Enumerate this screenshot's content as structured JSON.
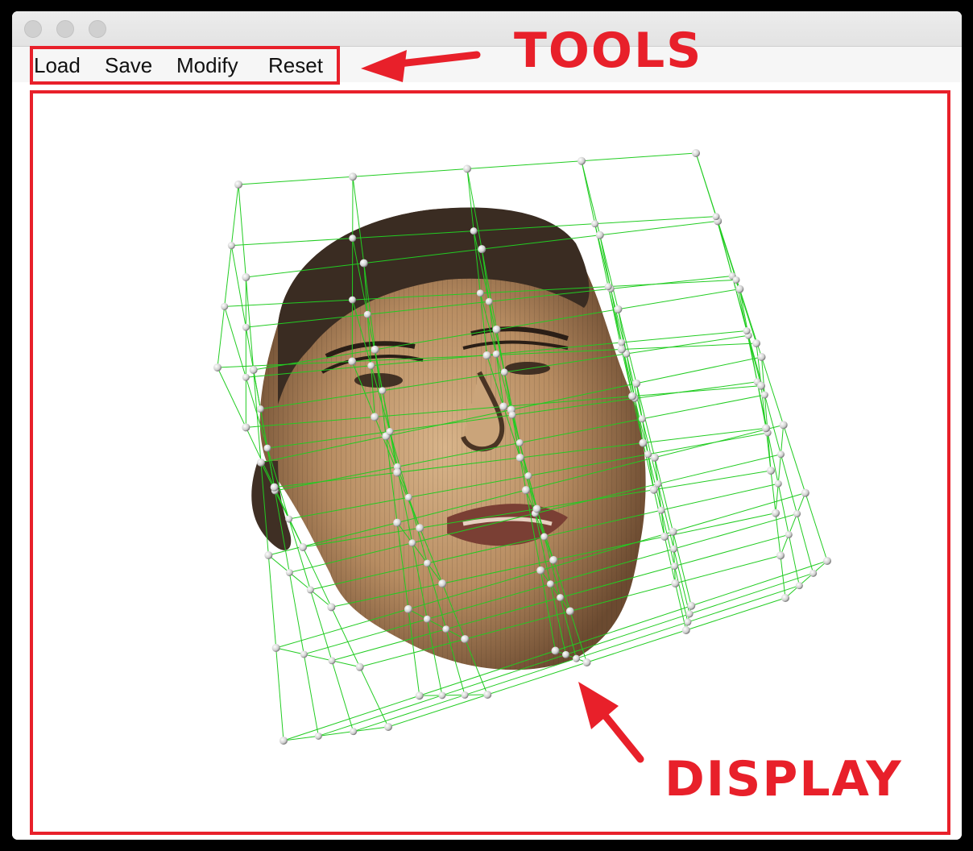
{
  "window": {
    "title_buttons": [
      "close",
      "minimize",
      "zoom"
    ]
  },
  "toolbar": {
    "load_label": "Load",
    "save_label": "Save",
    "modify_label": "Modify",
    "reset_label": "Reset"
  },
  "annotations": {
    "tools_label": "TOOLS",
    "display_label": "DISPLAY",
    "color": "#e8202a"
  },
  "display": {
    "content": "3d-face-mesh-with-lattice",
    "lattice_color": "#22cc22",
    "control_point_color": "#e6e6e6"
  }
}
